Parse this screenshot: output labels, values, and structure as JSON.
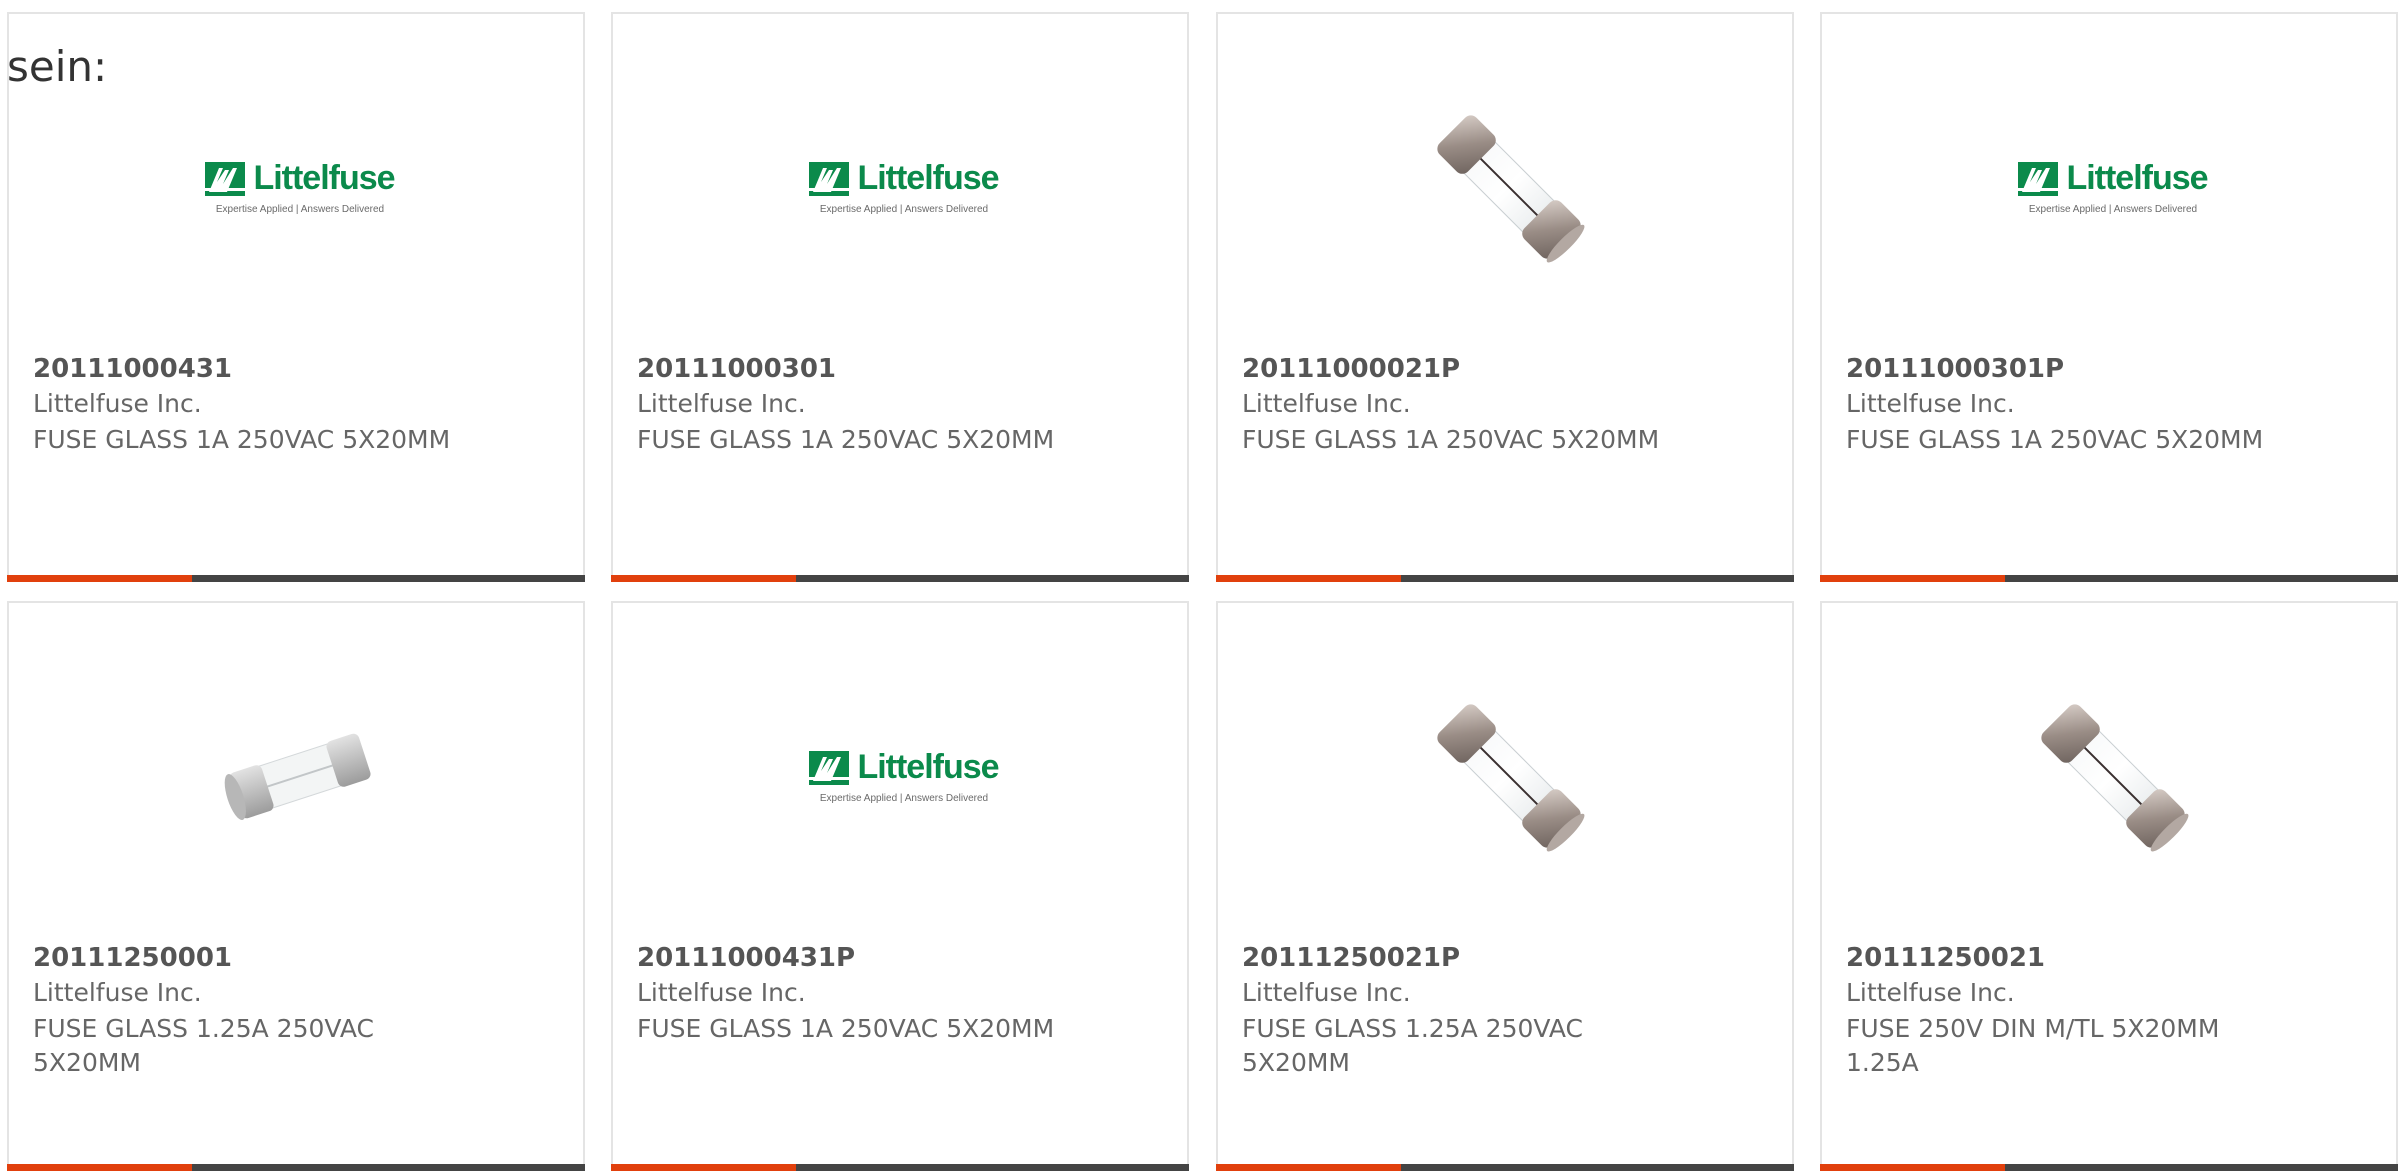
{
  "intro_text": "sein:",
  "logo": {
    "wordmark": "Littelfuse",
    "tagline": "Expertise Applied | Answers Delivered"
  },
  "colors": {
    "accent": "#e1400d",
    "bar": "#444444",
    "logo_green": "#0b8a4b",
    "border": "#e4e4e4"
  },
  "products": [
    {
      "part_number": "20111000431",
      "manufacturer": "Littelfuse Inc.",
      "description": "FUSE GLASS 1A 250VAC 5X20MM",
      "image": "littelfuse-logo"
    },
    {
      "part_number": "20111000301",
      "manufacturer": "Littelfuse Inc.",
      "description": "FUSE GLASS 1A 250VAC 5X20MM",
      "image": "littelfuse-logo"
    },
    {
      "part_number": "20111000021P",
      "manufacturer": "Littelfuse Inc.",
      "description": "FUSE GLASS 1A 250VAC 5X20MM",
      "image": "glass-fuse-photo"
    },
    {
      "part_number": "20111000301P",
      "manufacturer": "Littelfuse Inc.",
      "description": "FUSE GLASS 1A 250VAC 5X20MM",
      "image": "littelfuse-logo"
    },
    {
      "part_number": "20111250001",
      "manufacturer": "Littelfuse Inc.",
      "description": "FUSE GLASS 1.25A 250VAC 5X20MM",
      "image": "glass-fuse-render"
    },
    {
      "part_number": "20111000431P",
      "manufacturer": "Littelfuse Inc.",
      "description": "FUSE GLASS 1A 250VAC 5X20MM",
      "image": "littelfuse-logo"
    },
    {
      "part_number": "20111250021P",
      "manufacturer": "Littelfuse Inc.",
      "description": "FUSE GLASS 1.25A 250VAC 5X20MM",
      "image": "glass-fuse-photo"
    },
    {
      "part_number": "20111250021",
      "manufacturer": "Littelfuse Inc.",
      "description": "FUSE 250V DIN M/TL 5X20MM 1.25A",
      "image": "glass-fuse-photo"
    }
  ]
}
